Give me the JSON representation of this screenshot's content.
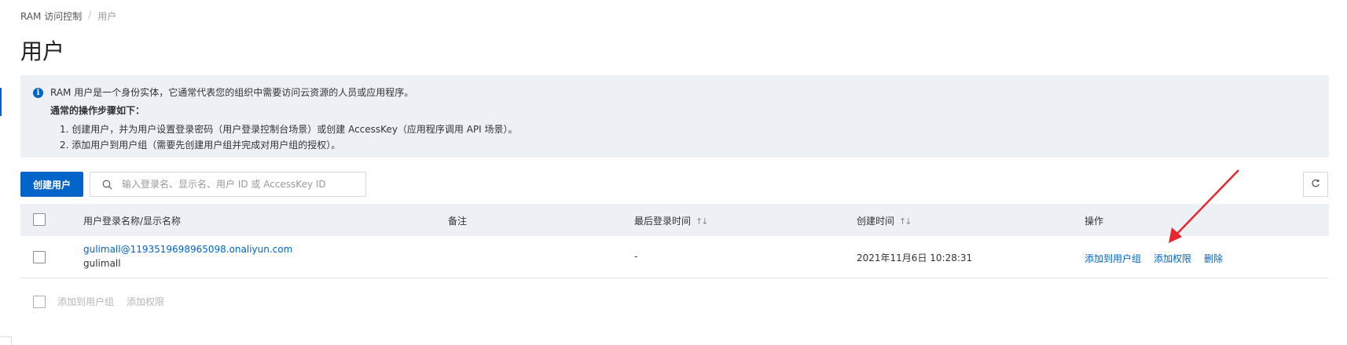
{
  "breadcrumb": {
    "root": "RAM 访问控制",
    "separator": "/",
    "current": "用户"
  },
  "page_title": "用户",
  "notice": {
    "icon": "info-icon",
    "line1": "RAM 用户是一个身份实体，它通常代表您的组织中需要访问云资源的人员或应用程序。",
    "line2": "通常的操作步骤如下：",
    "line3": "1. 创建用户，并为用户设置登录密码（用户登录控制台场景）或创建 AccessKey（应用程序调用 API 场景）。",
    "line4": "2. 添加用户到用户组（需要先创建用户组并完成对用户组的授权）。"
  },
  "toolbar": {
    "create_label": "创建用户",
    "search_placeholder": "输入登录名、显示名、用户 ID 或 AccessKey ID",
    "search_value": "",
    "refresh_icon": "refresh-icon"
  },
  "table": {
    "headers": {
      "name": "用户登录名称/显示名称",
      "note": "备注",
      "last_login": "最后登录时间",
      "created": "创建时间",
      "actions": "操作"
    },
    "rows": [
      {
        "login_name": "gulimall@1193519698965098.onaliyun.com",
        "display_name": "gulimall",
        "note": "",
        "last_login": "-",
        "created": "2021年11月6日 10:28:31",
        "action_add_group": "添加到用户组",
        "action_add_permission": "添加权限",
        "action_delete": "删除"
      }
    ]
  },
  "footer": {
    "add_to_group": "添加到用户组",
    "add_permission": "添加权限"
  },
  "colors": {
    "primary": "#0064c8",
    "notice_bg": "#edf1f6",
    "annotation_arrow": "#e8262d"
  }
}
